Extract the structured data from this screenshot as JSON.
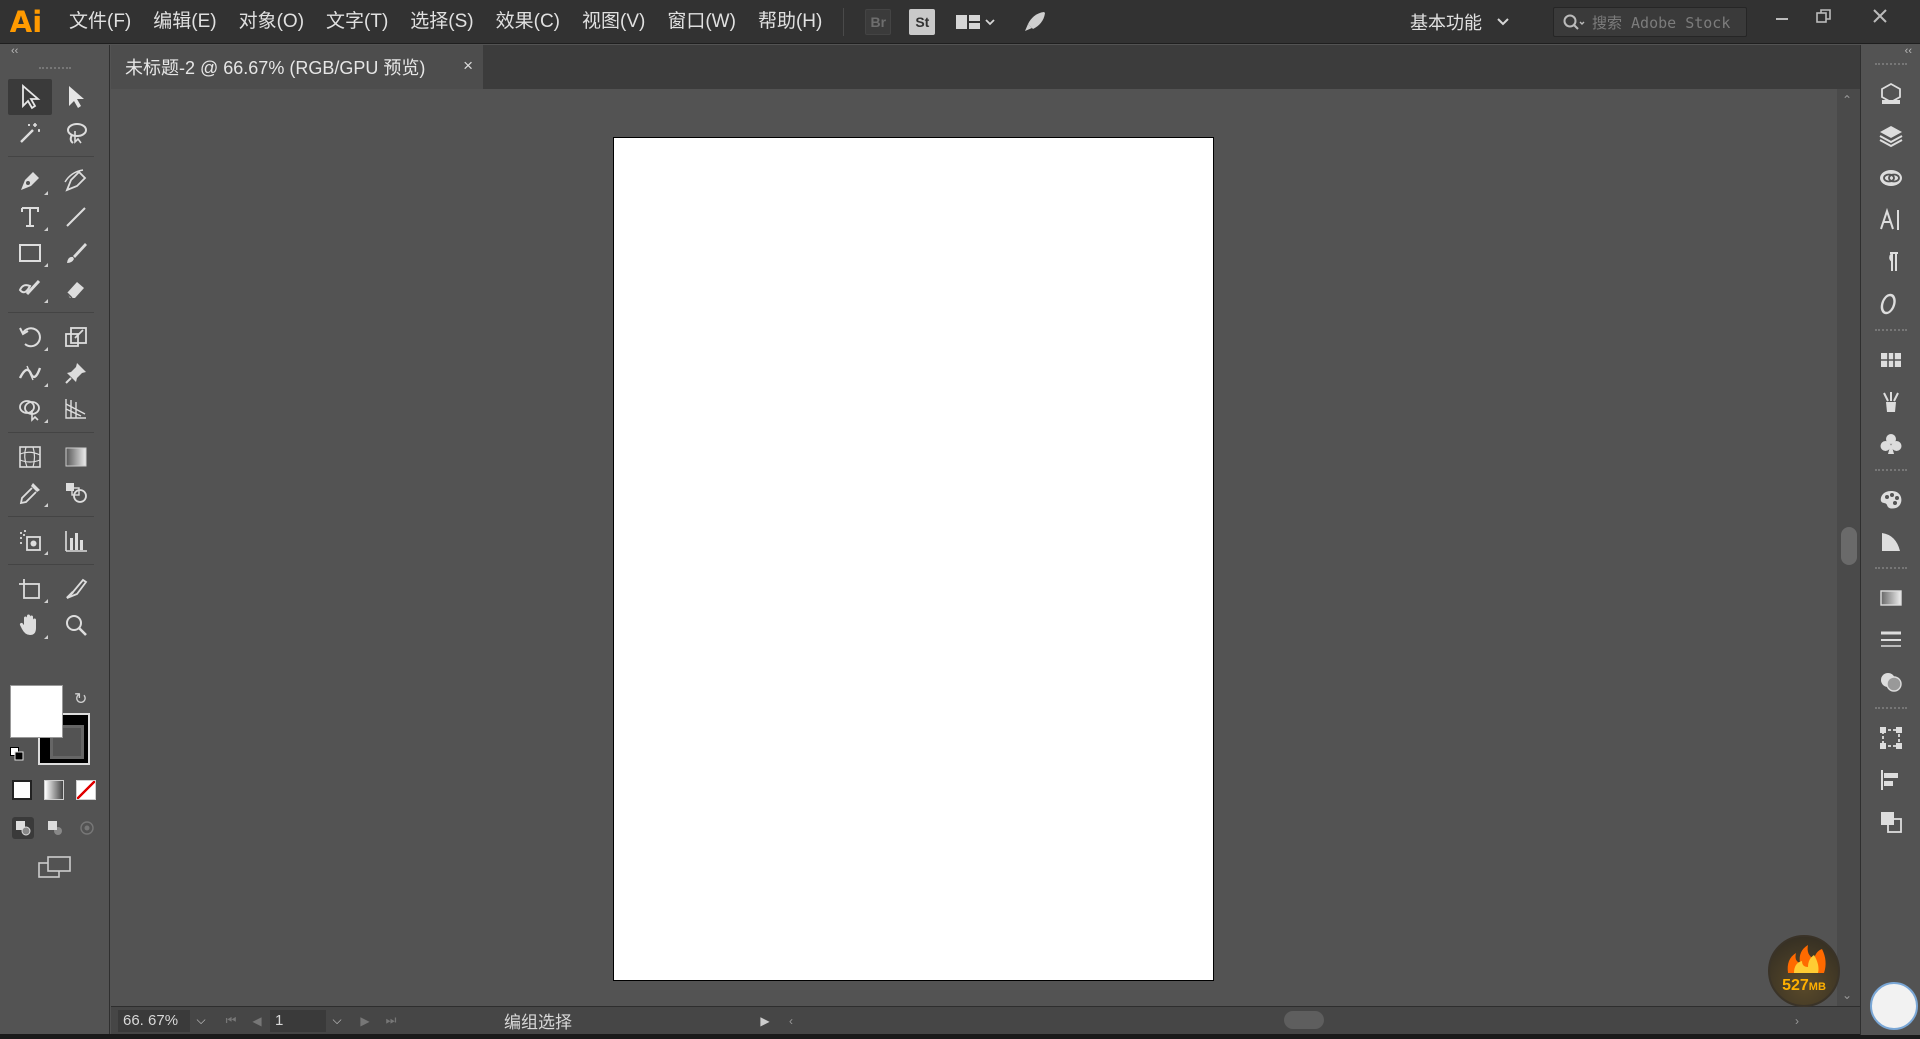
{
  "app": {
    "logo": "Ai",
    "colors": {
      "accent": "#ff9a00",
      "chrome": "#323232",
      "panel": "#535353",
      "artboard": "#ffffff"
    }
  },
  "menu": [
    "文件(F)",
    "编辑(E)",
    "对象(O)",
    "文字(T)",
    "选择(S)",
    "效果(C)",
    "视图(V)",
    "窗口(W)",
    "帮助(H)"
  ],
  "menubar_icons": {
    "bridge": "Br",
    "stock": "St"
  },
  "workspace": {
    "label": "基本功能"
  },
  "search": {
    "placeholder": "搜索 Adobe Stock"
  },
  "document": {
    "tab_title": "未标题-2 @ 66.67% (RGB/GPU 预览)",
    "close": "×"
  },
  "statusbar": {
    "zoom": "66. 67%",
    "page": "1",
    "status_text": "编组选择"
  },
  "memory_badge": {
    "value": "527",
    "unit": "MB"
  },
  "tools": [
    "selection-tool",
    "direct-selection-tool",
    "magic-wand-tool",
    "lasso-tool",
    "pen-tool",
    "curvature-tool",
    "type-tool",
    "line-segment-tool",
    "rectangle-tool",
    "paintbrush-tool",
    "shaper-tool",
    "eraser-tool",
    "rotate-tool",
    "scale-tool",
    "width-tool",
    "puppet-warp-tool",
    "shape-builder-tool",
    "perspective-grid-tool",
    "mesh-tool",
    "gradient-tool",
    "eyedropper-tool",
    "blend-tool",
    "symbol-sprayer-tool",
    "column-graph-tool",
    "artboard-tool",
    "slice-tool",
    "hand-tool",
    "zoom-tool"
  ],
  "right_panel_icons": [
    "libraries-icon",
    "layers-icon",
    "cc-libraries-icon",
    "character-icon",
    "paragraph-icon",
    "opentype-icon",
    "swatches-icon",
    "brushes-icon",
    "symbols-icon",
    "color-guide-icon",
    "appearance-icon",
    "gradient-panel-icon",
    "stroke-icon",
    "transparency-icon",
    "transform-icon",
    "align-icon",
    "pathfinder-icon"
  ]
}
